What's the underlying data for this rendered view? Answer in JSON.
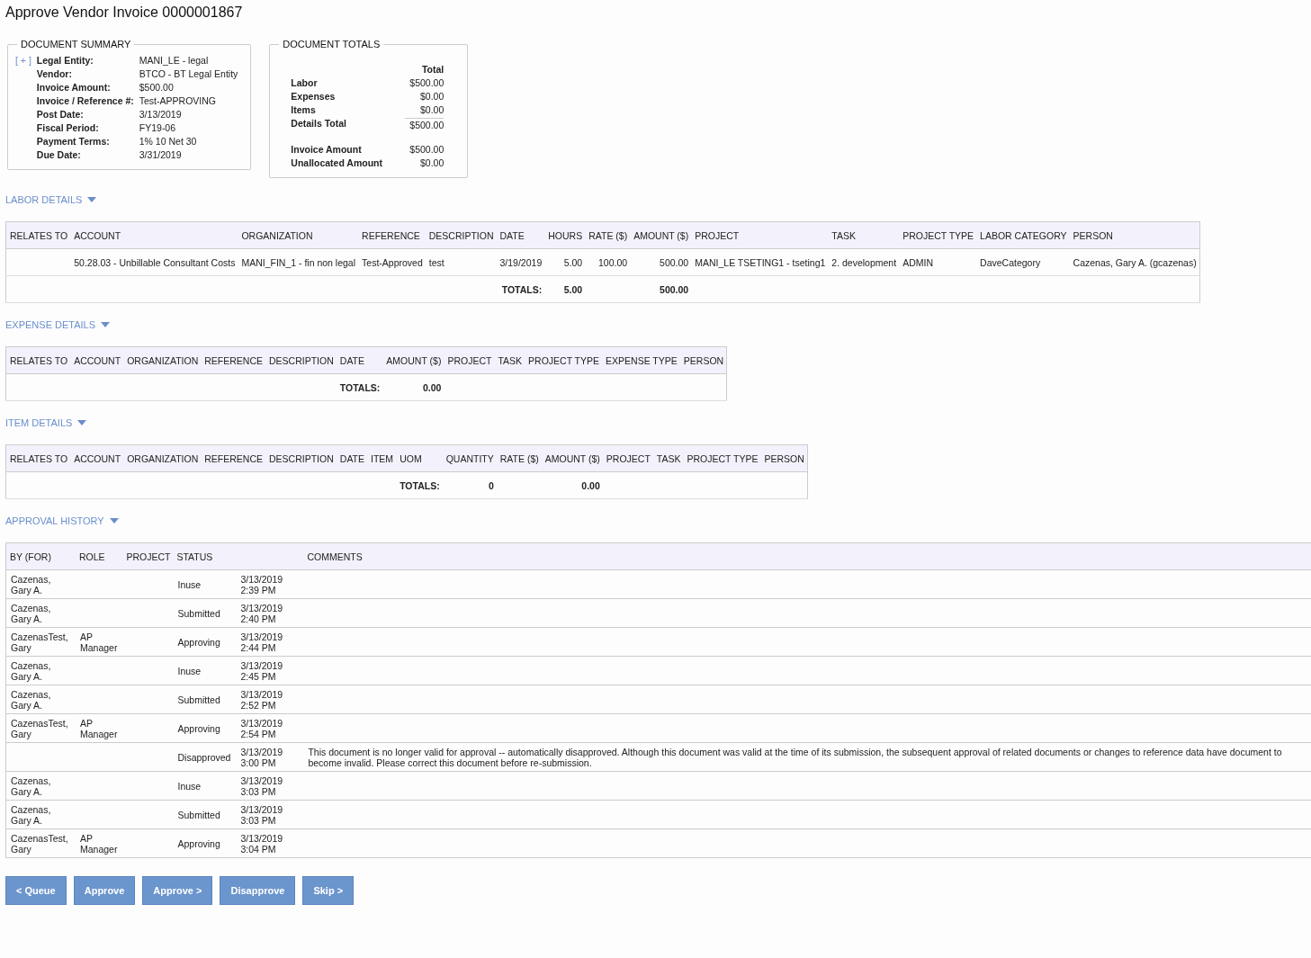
{
  "title": "Approve Vendor Invoice 0000001867",
  "summary": {
    "title": "DOCUMENT SUMMARY",
    "expander": "[ + ]",
    "fields": [
      {
        "label": "Legal Entity:",
        "value": "MANI_LE - legal"
      },
      {
        "label": "Vendor:",
        "value": "BTCO - BT Legal Entity"
      },
      {
        "label": "Invoice Amount:",
        "value": "$500.00"
      },
      {
        "label": "Invoice / Reference #:",
        "value": "Test-APPROVING"
      },
      {
        "label": "Post Date:",
        "value": "3/13/2019"
      },
      {
        "label": "Fiscal Period:",
        "value": "FY19-06"
      },
      {
        "label": "Payment Terms:",
        "value": "1% 10 Net 30"
      },
      {
        "label": "Due Date:",
        "value": "3/31/2019"
      }
    ]
  },
  "totals": {
    "title": "DOCUMENT TOTALS",
    "column": "Total",
    "groups": [
      [
        {
          "label": "Labor",
          "value": "$500.00",
          "kind": "line"
        },
        {
          "label": "Expenses",
          "value": "$0.00",
          "kind": "line"
        },
        {
          "label": "Items",
          "value": "$0.00",
          "kind": "line"
        },
        {
          "label": "Details Total",
          "value": "$500.00",
          "kind": "subtotal"
        }
      ],
      [
        {
          "label": "Invoice Amount",
          "value": "$500.00",
          "kind": "line"
        },
        {
          "label": "Unallocated Amount",
          "value": "$0.00",
          "kind": "line"
        }
      ]
    ]
  },
  "sections": [
    {
      "title": "LABOR DETAILS",
      "expanded": true,
      "columns": [
        {
          "label": "RELATES TO",
          "numeric": false
        },
        {
          "label": "ACCOUNT",
          "numeric": false,
          "values": [
            "50.28.03 - Unbillable Consultant Costs"
          ]
        },
        {
          "label": "ORGANIZATION",
          "numeric": false,
          "values": [
            "MANI_FIN_1 - fin non legal"
          ]
        },
        {
          "label": "REFERENCE",
          "numeric": false,
          "values": [
            "Test-Approved"
          ]
        },
        {
          "label": "DESCRIPTION",
          "numeric": false,
          "values": [
            "test"
          ]
        },
        {
          "label": "DATE",
          "numeric": false,
          "values": [
            "3/19/2019"
          ],
          "total": "TOTALS:"
        },
        {
          "label": "HOURS",
          "numeric": true,
          "values": [
            "5.00"
          ],
          "total": "5.00"
        },
        {
          "label": "RATE ($)",
          "numeric": true,
          "values": [
            "100.00"
          ]
        },
        {
          "label": "AMOUNT ($)",
          "numeric": true,
          "values": [
            "500.00"
          ],
          "total": "500.00"
        },
        {
          "label": "PROJECT",
          "numeric": false,
          "values": [
            "MANI_LE TSETING1 - tseting1"
          ]
        },
        {
          "label": "TASK",
          "numeric": false,
          "values": [
            "2. development"
          ]
        },
        {
          "label": "PROJECT TYPE",
          "numeric": false,
          "values": [
            "ADMIN"
          ]
        },
        {
          "label": "LABOR CATEGORY",
          "numeric": false,
          "values": [
            "DaveCategory"
          ]
        },
        {
          "label": "PERSON",
          "numeric": false,
          "values": [
            "Cazenas, Gary A. (gcazenas)"
          ]
        }
      ]
    },
    {
      "title": "EXPENSE DETAILS",
      "expanded": true,
      "columns": [
        {
          "label": "RELATES TO",
          "numeric": false
        },
        {
          "label": "ACCOUNT",
          "numeric": false
        },
        {
          "label": "ORGANIZATION",
          "numeric": false
        },
        {
          "label": "REFERENCE",
          "numeric": false
        },
        {
          "label": "DESCRIPTION",
          "numeric": false
        },
        {
          "label": "DATE",
          "numeric": false,
          "total": "TOTALS:"
        },
        {
          "label": "AMOUNT ($)",
          "numeric": true,
          "total": "0.00"
        },
        {
          "label": "PROJECT",
          "numeric": false
        },
        {
          "label": "TASK",
          "numeric": false
        },
        {
          "label": "PROJECT TYPE",
          "numeric": false
        },
        {
          "label": "EXPENSE TYPE",
          "numeric": false
        },
        {
          "label": "PERSON",
          "numeric": false
        }
      ]
    },
    {
      "title": "ITEM DETAILS",
      "expanded": true,
      "columns": [
        {
          "label": "RELATES TO",
          "numeric": false
        },
        {
          "label": "ACCOUNT",
          "numeric": false
        },
        {
          "label": "ORGANIZATION",
          "numeric": false
        },
        {
          "label": "REFERENCE",
          "numeric": false
        },
        {
          "label": "DESCRIPTION",
          "numeric": false
        },
        {
          "label": "DATE",
          "numeric": false
        },
        {
          "label": "ITEM",
          "numeric": false
        },
        {
          "label": "UOM",
          "numeric": false,
          "total": "TOTALS:"
        },
        {
          "label": "QUANTITY",
          "numeric": true,
          "total": "0"
        },
        {
          "label": "RATE ($)",
          "numeric": true
        },
        {
          "label": "AMOUNT ($)",
          "numeric": true,
          "total": "0.00"
        },
        {
          "label": "PROJECT",
          "numeric": false
        },
        {
          "label": "TASK",
          "numeric": false
        },
        {
          "label": "PROJECT TYPE",
          "numeric": false
        },
        {
          "label": "PERSON",
          "numeric": false
        }
      ]
    }
  ],
  "history": {
    "title": "APPROVAL HISTORY",
    "expanded": true,
    "columns": [
      "BY (FOR)",
      "ROLE",
      "PROJECT",
      "STATUS",
      "COMMENTS"
    ],
    "rows": [
      {
        "by": "Cazenas, Gary A.",
        "status": "Inuse",
        "date": "3/13/2019",
        "time": "2:39 PM"
      },
      {
        "by": "Cazenas, Gary A.",
        "status": "Submitted",
        "date": "3/13/2019",
        "time": "2:40 PM"
      },
      {
        "by": "CazenasTest, Gary",
        "role": "AP Manager",
        "status": "Approving",
        "date": "3/13/2019",
        "time": "2:44 PM"
      },
      {
        "by": "Cazenas, Gary A.",
        "status": "Inuse",
        "date": "3/13/2019",
        "time": "2:45 PM"
      },
      {
        "by": "Cazenas, Gary A.",
        "status": "Submitted",
        "date": "3/13/2019",
        "time": "2:52 PM"
      },
      {
        "by": "CazenasTest, Gary",
        "role": "AP Manager",
        "status": "Approving",
        "date": "3/13/2019",
        "time": "2:54 PM"
      },
      {
        "status": "Disapproved",
        "date": "3/13/2019",
        "time": "3:00 PM",
        "comment": "This document is no longer valid for approval -- automatically disapproved. Although this document was valid at the time of its submission, the subsequent approval of related documents or changes to reference data have document to become invalid. Please correct this document before re-submission."
      },
      {
        "by": "Cazenas, Gary A.",
        "status": "Inuse",
        "date": "3/13/2019",
        "time": "3:03 PM"
      },
      {
        "by": "Cazenas, Gary A.",
        "status": "Submitted",
        "date": "3/13/2019",
        "time": "3:03 PM"
      },
      {
        "by": "CazenasTest, Gary",
        "role": "AP Manager",
        "status": "Approving",
        "date": "3/13/2019",
        "time": "3:04 PM"
      }
    ]
  },
  "buttons": [
    "< Queue",
    "Approve",
    "Approve >",
    "Disapprove",
    "Skip >"
  ]
}
